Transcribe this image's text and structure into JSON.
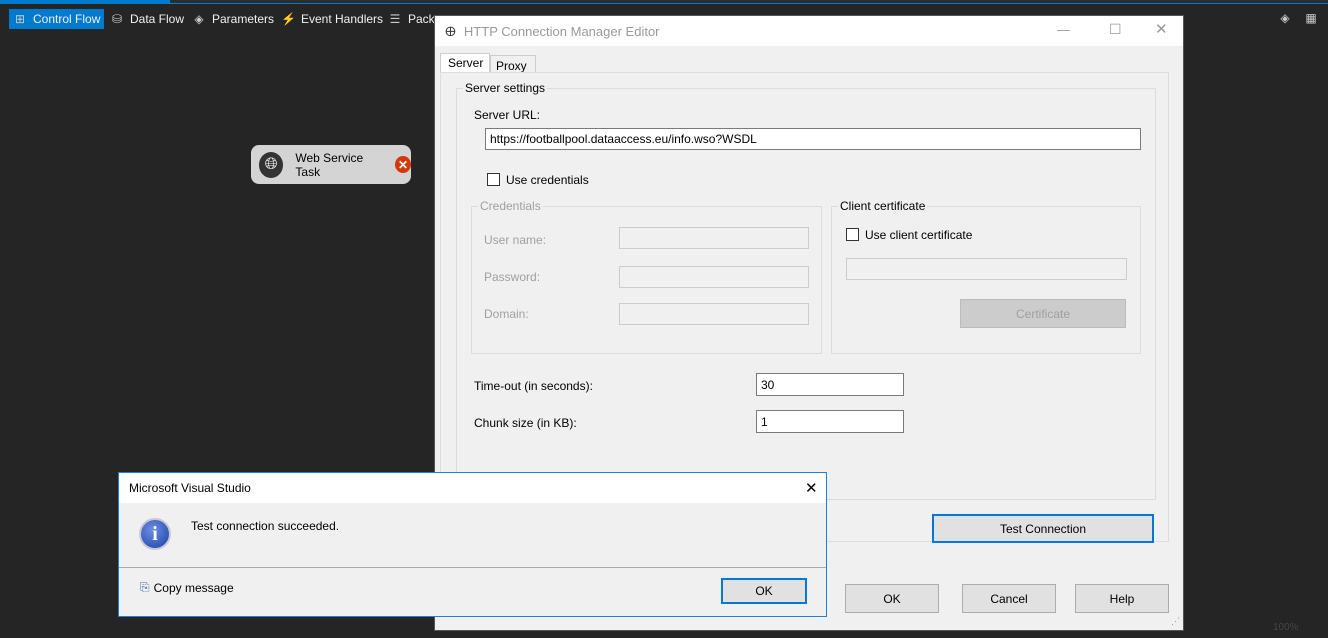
{
  "toolbar": {
    "tabs": [
      {
        "label": "Control Flow",
        "icon": "control-flow-icon",
        "active": true
      },
      {
        "label": "Data Flow",
        "icon": "data-flow-icon"
      },
      {
        "label": "Parameters",
        "icon": "parameters-icon"
      },
      {
        "label": "Event Handlers",
        "icon": "event-handlers-icon"
      },
      {
        "label": "Packa",
        "icon": "package-explorer-icon"
      }
    ]
  },
  "canvas": {
    "task_label": "Web Service Task",
    "zoom": "100%"
  },
  "editor": {
    "title": "HTTP Connection Manager Editor",
    "tabs": [
      "Server",
      "Proxy"
    ],
    "server_settings": "Server settings",
    "server_url_label": "Server URL:",
    "server_url": "https://footballpool.dataaccess.eu/info.wso?WSDL",
    "use_credentials": "Use credentials",
    "credentials": "Credentials",
    "user_name": "User name:",
    "password": "Password:",
    "domain": "Domain:",
    "client_certificate": "Client certificate",
    "use_client_certificate": "Use client certificate",
    "certificate_button": "Certificate",
    "timeout_label": "Time-out (in seconds):",
    "timeout": "30",
    "chunk_label": "Chunk size (in KB):",
    "chunk": "1",
    "test_connection": "Test Connection",
    "ok": "OK",
    "cancel": "Cancel",
    "help": "Help"
  },
  "msgbox": {
    "title": "Microsoft Visual Studio",
    "message": "Test connection succeeded.",
    "copy": "Copy message",
    "ok": "OK"
  },
  "colors": {
    "accent": "#007acc",
    "background": "#252526",
    "dialog": "#f0f0f0"
  }
}
